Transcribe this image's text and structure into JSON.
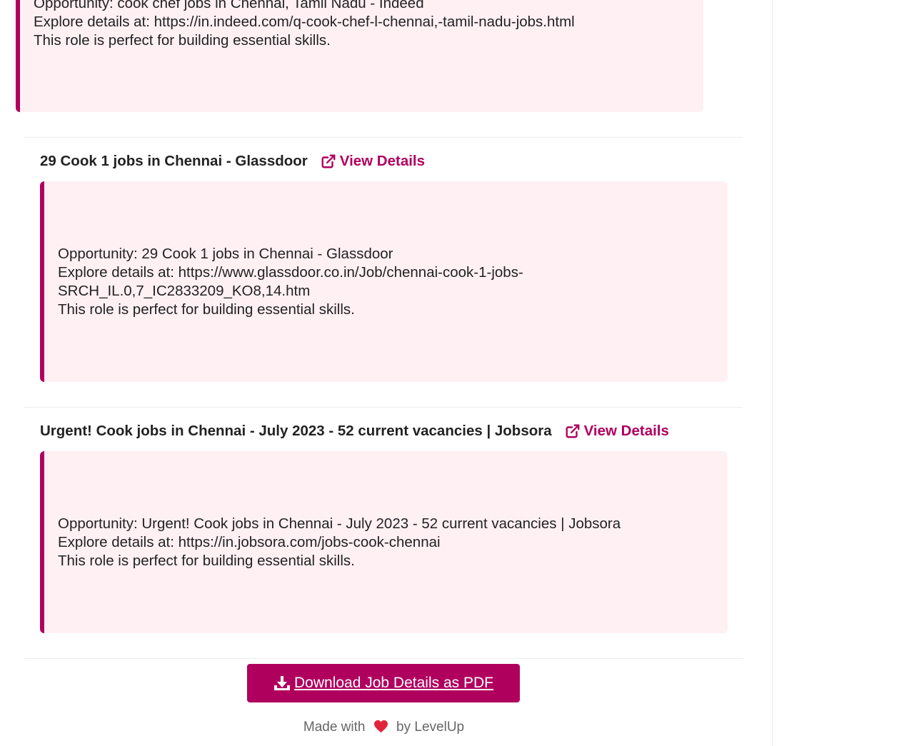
{
  "jobs": [
    {
      "title": "",
      "view_label": "",
      "lines": [
        "Opportunity: cook chef jobs in Chennai, Tamil Nadu - Indeed",
        "Explore details at: https://in.indeed.com/q-cook-chef-l-chennai,-tamil-nadu-jobs.html",
        "This role is perfect for building essential skills."
      ]
    },
    {
      "title": "29 Cook 1 jobs in Chennai - Glassdoor",
      "view_label": "View Details",
      "lines": [
        "Opportunity: 29 Cook 1 jobs in Chennai - Glassdoor",
        "Explore details at: https://www.glassdoor.co.in/Job/chennai-cook-1-jobs-",
        "SRCH_IL.0,7_IC2833209_KO8,14.htm",
        "This role is perfect for building essential skills."
      ]
    },
    {
      "title": "Urgent! Cook jobs in Chennai - July 2023 - 52 current vacancies | Jobsora",
      "view_label": "View Details",
      "lines": [
        "Opportunity: Urgent! Cook jobs in Chennai - July 2023 - 52 current vacancies | Jobsora",
        "Explore details at: https://in.jobsora.com/jobs-cook-chennai",
        "This role is perfect for building essential skills."
      ]
    }
  ],
  "download": {
    "label": "Download Job Details as PDF",
    "icon": "download-icon"
  },
  "footer": {
    "made_with": "Made with",
    "by": "by LevelUp",
    "icon": "heart-icon"
  },
  "colors": {
    "accent": "#b0005e",
    "box_bg": "#fff0f4",
    "heart": "#e0253a"
  }
}
